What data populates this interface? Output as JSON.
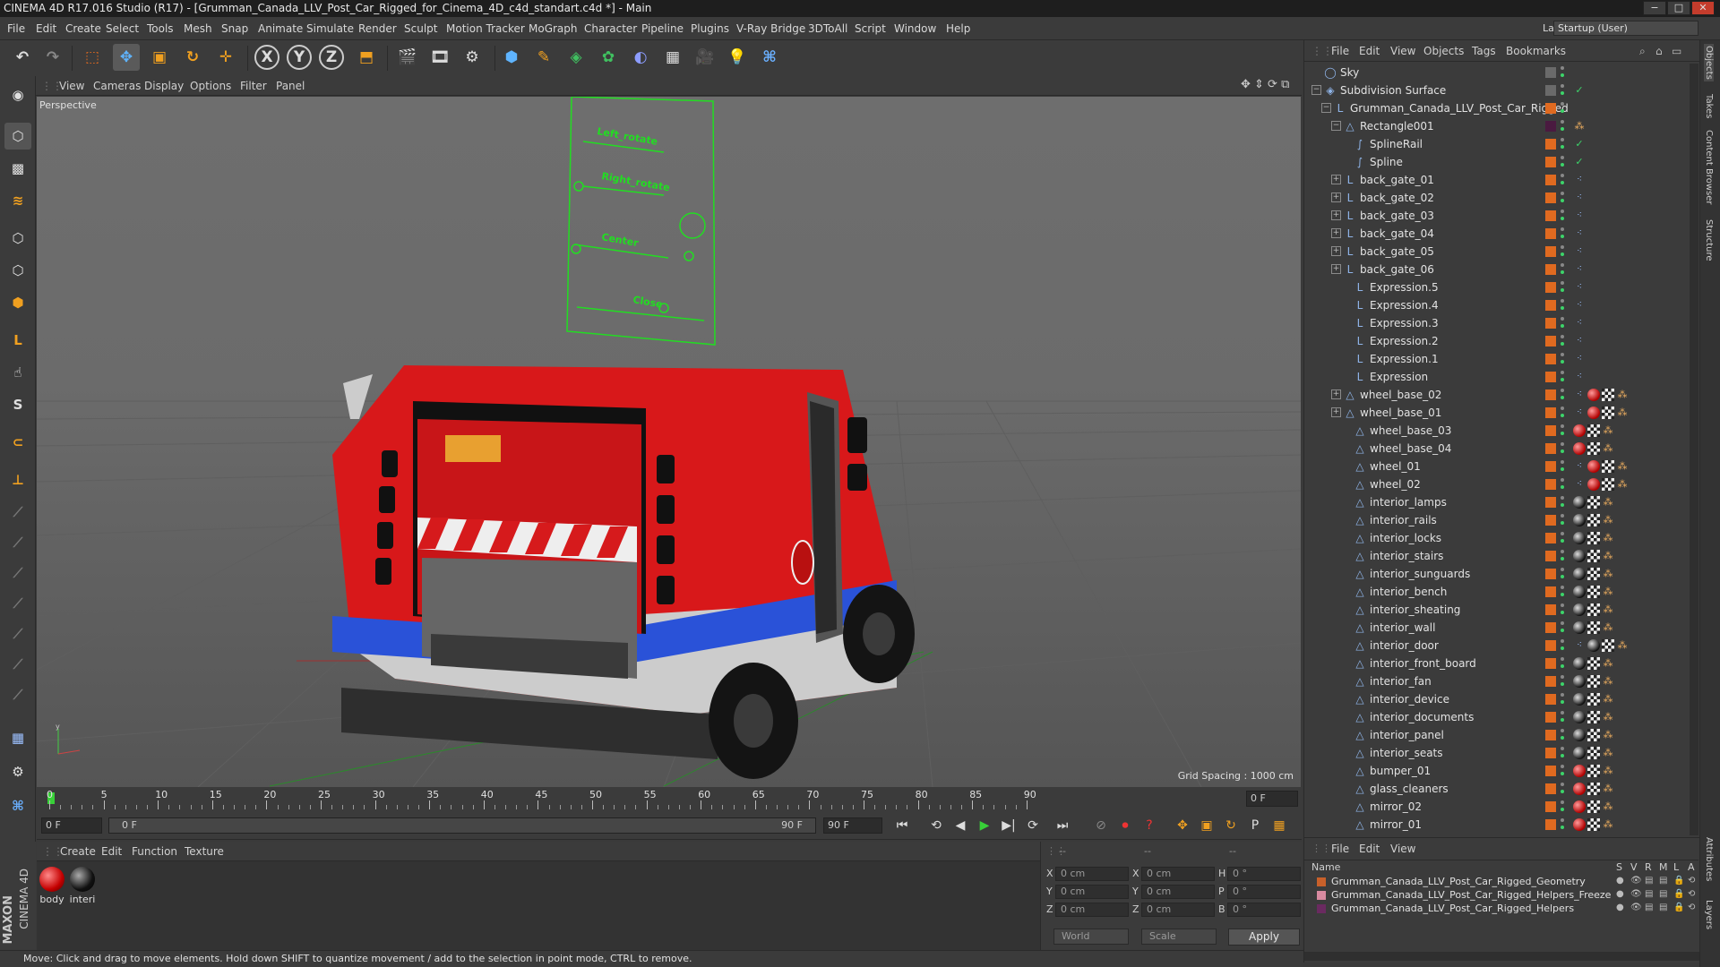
{
  "window": {
    "title": "CINEMA 4D R17.016 Studio (R17) - [Grumman_Canada_LLV_Post_Car_Rigged_for_Cinema_4D_c4d_standart.c4d *] - Main"
  },
  "menubar": {
    "items": [
      "File",
      "Edit",
      "Create",
      "Select",
      "Tools",
      "Mesh",
      "Snap",
      "Animate",
      "Simulate",
      "Render",
      "Sculpt",
      "Motion Tracker",
      "MoGraph",
      "Character",
      "Pipeline",
      "Plugins",
      "V-Ray Bridge",
      "3DToAll",
      "Script",
      "Window",
      "Help"
    ],
    "layout_label": "Layout:",
    "layout_value": "Startup (User)"
  },
  "viewport": {
    "menu": [
      "View",
      "Cameras",
      "Display",
      "Options",
      "Filter",
      "Panel"
    ],
    "label": "Perspective",
    "grid_spacing": "Grid Spacing : 1000 cm",
    "hud_labels": [
      "Left_rotate",
      "Right_rotate",
      "Center",
      "Close"
    ]
  },
  "timeline": {
    "ticks": [
      "0",
      "5",
      "10",
      "15",
      "20",
      "25",
      "30",
      "35",
      "40",
      "45",
      "50",
      "55",
      "60",
      "65",
      "70",
      "75",
      "80",
      "85",
      "90"
    ],
    "current_frame": "0 F",
    "start_frame": "0 F",
    "range_start": "0 F",
    "range_end": "90 F",
    "end_frame": "90 F"
  },
  "materials": {
    "menu": [
      "Create",
      "Edit",
      "Function",
      "Texture"
    ],
    "items": [
      {
        "name": "body",
        "color": "#cc1010"
      },
      {
        "name": "interi",
        "color": "#222222"
      }
    ]
  },
  "coordinates": {
    "headers": [
      "--",
      "--",
      "--"
    ],
    "rows": [
      {
        "axis": "X",
        "pos": "0 cm",
        "size_axis": "X",
        "size": "0 cm",
        "rot_axis": "H",
        "rot": "0 °"
      },
      {
        "axis": "Y",
        "pos": "0 cm",
        "size_axis": "Y",
        "size": "0 cm",
        "rot_axis": "P",
        "rot": "0 °"
      },
      {
        "axis": "Z",
        "pos": "0 cm",
        "size_axis": "Z",
        "size": "0 cm",
        "rot_axis": "B",
        "rot": "0 °"
      }
    ],
    "mode": "World",
    "transform": "Scale",
    "apply": "Apply"
  },
  "logo": {
    "line1": "MAXON",
    "line2": "CINEMA 4D"
  },
  "statusbar": {
    "text": "Move: Click and drag to move elements. Hold down SHIFT to quantize movement / add to the selection in point mode, CTRL to remove."
  },
  "object_manager": {
    "menu": [
      "File",
      "Edit",
      "View",
      "Objects",
      "Tags",
      "Bookmarks"
    ],
    "objects": [
      {
        "name": "Sky",
        "indent": 0,
        "expand": "",
        "icon": "◯",
        "tags": []
      },
      {
        "name": "Subdivision Surface",
        "indent": 0,
        "expand": "−",
        "icon": "◈",
        "tags": [
          "check"
        ]
      },
      {
        "name": "Grumman_Canada_LLV_Post_Car_Rigged",
        "indent": 1,
        "expand": "−",
        "icon": "L",
        "tags": []
      },
      {
        "name": "Rectangle001",
        "indent": 2,
        "expand": "−",
        "icon": "△",
        "tags": [
          "sel"
        ]
      },
      {
        "name": "SplineRail",
        "indent": 3,
        "expand": "",
        "icon": "∫",
        "tags": [
          "check"
        ]
      },
      {
        "name": "Spline",
        "indent": 3,
        "expand": "",
        "icon": "∫",
        "tags": [
          "check"
        ]
      },
      {
        "name": "back_gate_01",
        "indent": 2,
        "expand": "+",
        "icon": "L",
        "tags": [
          "xp"
        ]
      },
      {
        "name": "back_gate_02",
        "indent": 2,
        "expand": "+",
        "icon": "L",
        "tags": [
          "xp"
        ]
      },
      {
        "name": "back_gate_03",
        "indent": 2,
        "expand": "+",
        "icon": "L",
        "tags": [
          "xp"
        ]
      },
      {
        "name": "back_gate_04",
        "indent": 2,
        "expand": "+",
        "icon": "L",
        "tags": [
          "xp"
        ]
      },
      {
        "name": "back_gate_05",
        "indent": 2,
        "expand": "+",
        "icon": "L",
        "tags": [
          "xp"
        ]
      },
      {
        "name": "back_gate_06",
        "indent": 2,
        "expand": "+",
        "icon": "L",
        "tags": [
          "xp"
        ]
      },
      {
        "name": "Expression.5",
        "indent": 3,
        "expand": "",
        "icon": "L",
        "tags": [
          "xp"
        ]
      },
      {
        "name": "Expression.4",
        "indent": 3,
        "expand": "",
        "icon": "L",
        "tags": [
          "xp"
        ]
      },
      {
        "name": "Expression.3",
        "indent": 3,
        "expand": "",
        "icon": "L",
        "tags": [
          "xp"
        ]
      },
      {
        "name": "Expression.2",
        "indent": 3,
        "expand": "",
        "icon": "L",
        "tags": [
          "xp"
        ]
      },
      {
        "name": "Expression.1",
        "indent": 3,
        "expand": "",
        "icon": "L",
        "tags": [
          "xp"
        ]
      },
      {
        "name": "Expression",
        "indent": 3,
        "expand": "",
        "icon": "L",
        "tags": [
          "xp"
        ]
      },
      {
        "name": "wheel_base_02",
        "indent": 2,
        "expand": "+",
        "icon": "△",
        "tags": [
          "xp",
          "red",
          "chk",
          "sel"
        ]
      },
      {
        "name": "wheel_base_01",
        "indent": 2,
        "expand": "+",
        "icon": "△",
        "tags": [
          "xp",
          "red",
          "chk",
          "sel"
        ]
      },
      {
        "name": "wheel_base_03",
        "indent": 3,
        "expand": "",
        "icon": "△",
        "tags": [
          "red",
          "chk",
          "sel"
        ]
      },
      {
        "name": "wheel_base_04",
        "indent": 3,
        "expand": "",
        "icon": "△",
        "tags": [
          "red",
          "chk",
          "sel"
        ]
      },
      {
        "name": "wheel_01",
        "indent": 3,
        "expand": "",
        "icon": "△",
        "tags": [
          "xp",
          "red",
          "chk",
          "sel"
        ]
      },
      {
        "name": "wheel_02",
        "indent": 3,
        "expand": "",
        "icon": "△",
        "tags": [
          "xp",
          "red",
          "chk",
          "sel"
        ]
      },
      {
        "name": "interior_lamps",
        "indent": 3,
        "expand": "",
        "icon": "△",
        "tags": [
          "phong",
          "chk",
          "sel"
        ]
      },
      {
        "name": "interior_rails",
        "indent": 3,
        "expand": "",
        "icon": "△",
        "tags": [
          "phong",
          "chk",
          "sel"
        ]
      },
      {
        "name": "interior_locks",
        "indent": 3,
        "expand": "",
        "icon": "△",
        "tags": [
          "phong",
          "chk",
          "sel"
        ]
      },
      {
        "name": "interior_stairs",
        "indent": 3,
        "expand": "",
        "icon": "△",
        "tags": [
          "phong",
          "chk",
          "sel"
        ]
      },
      {
        "name": "interior_sunguards",
        "indent": 3,
        "expand": "",
        "icon": "△",
        "tags": [
          "phong",
          "chk",
          "sel"
        ]
      },
      {
        "name": "interior_bench",
        "indent": 3,
        "expand": "",
        "icon": "△",
        "tags": [
          "phong",
          "chk",
          "sel"
        ]
      },
      {
        "name": "interior_sheating",
        "indent": 3,
        "expand": "",
        "icon": "△",
        "tags": [
          "phong",
          "chk",
          "sel"
        ]
      },
      {
        "name": "interior_wall",
        "indent": 3,
        "expand": "",
        "icon": "△",
        "tags": [
          "phong",
          "chk",
          "sel"
        ]
      },
      {
        "name": "interior_door",
        "indent": 3,
        "expand": "",
        "icon": "△",
        "tags": [
          "xp",
          "phong",
          "chk",
          "sel"
        ]
      },
      {
        "name": "interior_front_board",
        "indent": 3,
        "expand": "",
        "icon": "△",
        "tags": [
          "phong",
          "chk",
          "sel"
        ]
      },
      {
        "name": "interior_fan",
        "indent": 3,
        "expand": "",
        "icon": "△",
        "tags": [
          "phong",
          "chk",
          "sel"
        ]
      },
      {
        "name": "interior_device",
        "indent": 3,
        "expand": "",
        "icon": "△",
        "tags": [
          "phong",
          "chk",
          "sel"
        ]
      },
      {
        "name": "interior_documents",
        "indent": 3,
        "expand": "",
        "icon": "△",
        "tags": [
          "phong",
          "chk",
          "sel"
        ]
      },
      {
        "name": "interior_panel",
        "indent": 3,
        "expand": "",
        "icon": "△",
        "tags": [
          "phong",
          "chk",
          "sel"
        ]
      },
      {
        "name": "interior_seats",
        "indent": 3,
        "expand": "",
        "icon": "△",
        "tags": [
          "phong",
          "chk",
          "sel"
        ]
      },
      {
        "name": "bumper_01",
        "indent": 3,
        "expand": "",
        "icon": "△",
        "tags": [
          "red",
          "chk",
          "sel"
        ]
      },
      {
        "name": "glass_cleaners",
        "indent": 3,
        "expand": "",
        "icon": "△",
        "tags": [
          "red",
          "chk",
          "sel"
        ]
      },
      {
        "name": "mirror_02",
        "indent": 3,
        "expand": "",
        "icon": "△",
        "tags": [
          "red",
          "chk",
          "sel"
        ]
      },
      {
        "name": "mirror_01",
        "indent": 3,
        "expand": "",
        "icon": "△",
        "tags": [
          "red",
          "chk",
          "sel"
        ]
      }
    ]
  },
  "layer_manager": {
    "menu": [
      "File",
      "Edit",
      "View"
    ],
    "name_header": "Name",
    "col_headers": [
      "S",
      "V",
      "R",
      "M",
      "L",
      "A"
    ],
    "layers": [
      {
        "name": "Grumman_Canada_LLV_Post_Car_Rigged_Geometry",
        "color": "#c8602a"
      },
      {
        "name": "Grumman_Canada_LLV_Post_Car_Rigged_Helpers_Freeze",
        "color": "#d88aa0"
      },
      {
        "name": "Grumman_Canada_LLV_Post_Car_Rigged_Helpers",
        "color": "#6a2a60"
      }
    ]
  },
  "right_tabs": [
    "Objects",
    "Takes",
    "Content Browser",
    "Structure",
    "Attributes",
    "Layers"
  ]
}
